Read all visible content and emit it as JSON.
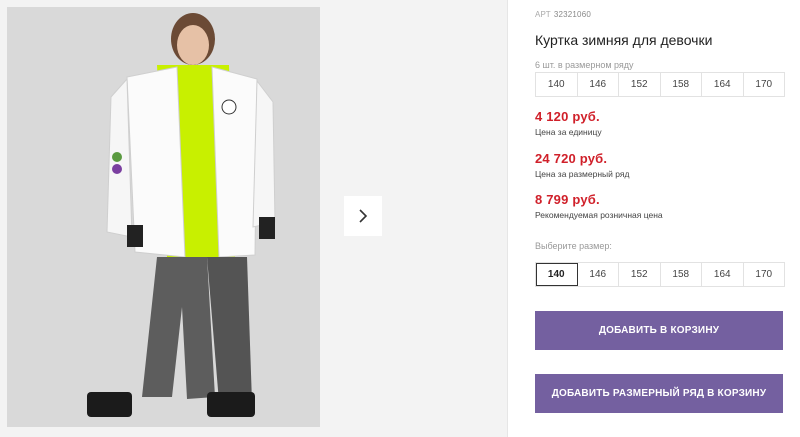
{
  "product": {
    "sku_label": "АРТ",
    "sku": "32321060",
    "title": "Куртка зимняя для девочки",
    "row_note": "6 шт. в размерном ряду",
    "row_sizes": [
      "140",
      "146",
      "152",
      "158",
      "164",
      "170"
    ]
  },
  "prices": [
    {
      "value": "4 120 руб.",
      "label": "Цена за единицу"
    },
    {
      "value": "24 720 руб.",
      "label": "Цена за размерный ряд"
    },
    {
      "value": "8 799 руб.",
      "label": "Рекомендуемая розничная цена"
    }
  ],
  "size_select": {
    "label": "Выберите размер:",
    "options": [
      "140",
      "146",
      "152",
      "158",
      "164",
      "170"
    ],
    "selected": "140"
  },
  "buttons": {
    "add_to_cart": "ДОБАВИТЬ В КОРЗИНУ",
    "add_row_to_cart": "ДОБАВИТЬ РАЗМЕРНЫЙ РЯД В КОРЗИНУ"
  },
  "colors": {
    "price": "#d0202a",
    "button": "#7460a0",
    "jacket": "#ffffff",
    "accent_lining": "#c8f000"
  },
  "icons": {
    "next": "chevron-right-icon"
  }
}
